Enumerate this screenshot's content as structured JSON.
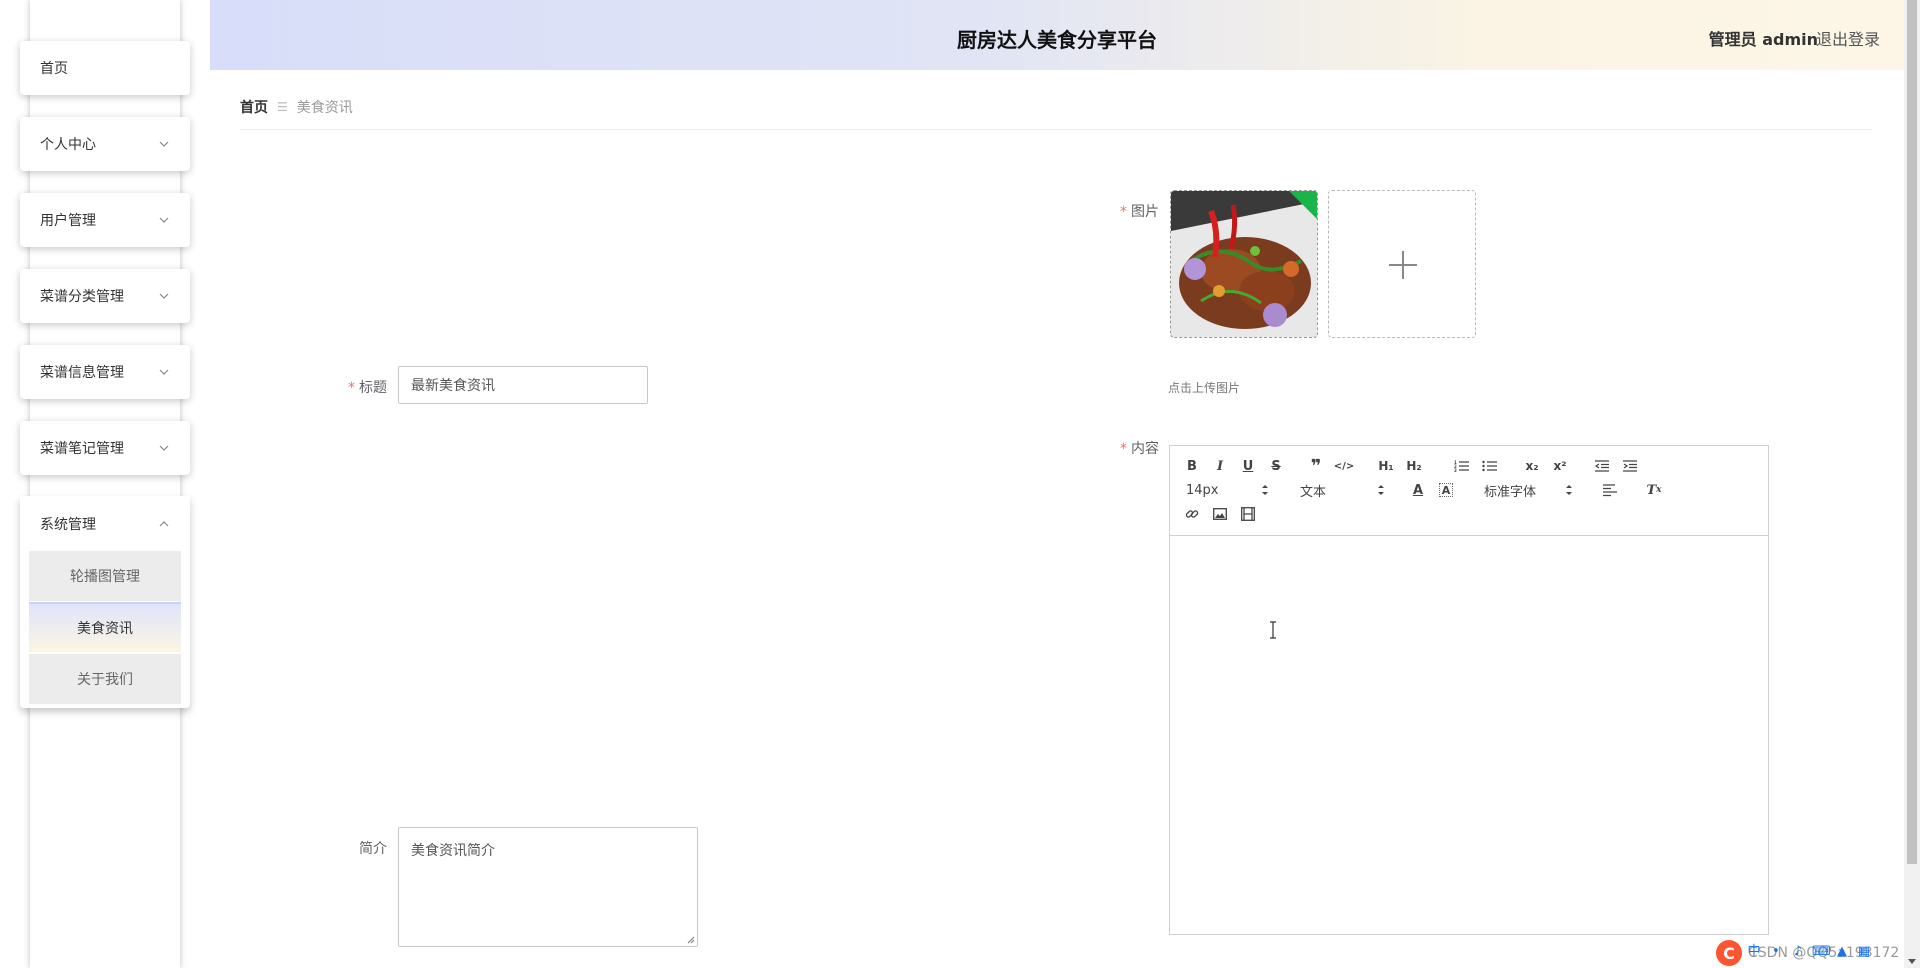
{
  "header": {
    "title": "厨房达人美食分享平台",
    "user_label": "管理员 admin",
    "logout_label": "退出登录"
  },
  "sidebar": {
    "items": [
      {
        "label": "首页",
        "has_chevron": false
      },
      {
        "label": "个人中心",
        "has_chevron": true
      },
      {
        "label": "用户管理",
        "has_chevron": true
      },
      {
        "label": "菜谱分类管理",
        "has_chevron": true
      },
      {
        "label": "菜谱信息管理",
        "has_chevron": true
      },
      {
        "label": "菜谱笔记管理",
        "has_chevron": true
      },
      {
        "label": "系统管理",
        "has_chevron": true,
        "expanded": true
      }
    ],
    "submenu": [
      {
        "label": "轮播图管理",
        "active": false
      },
      {
        "label": "美食资讯",
        "active": true
      },
      {
        "label": "关于我们",
        "active": false
      }
    ]
  },
  "breadcrumb": {
    "home": "首页",
    "separator": "☰",
    "current": "美食资讯"
  },
  "form": {
    "title_label": "标题",
    "title_value": "最新美食资讯",
    "image_label": "图片",
    "upload_tip": "点击上传图片",
    "content_label": "内容",
    "summary_label": "简介",
    "summary_value": "美食资讯简介"
  },
  "editor": {
    "size_select": "14px",
    "header_select": "文本",
    "font_select": "标准字体"
  },
  "watermark": {
    "text": "CSDN @QQ5a193172"
  },
  "colors": {
    "required_star": "#f56c6c",
    "header_left": "#d8def9",
    "header_right": "#fdf6e6",
    "csdn_red": "#fc5531"
  }
}
